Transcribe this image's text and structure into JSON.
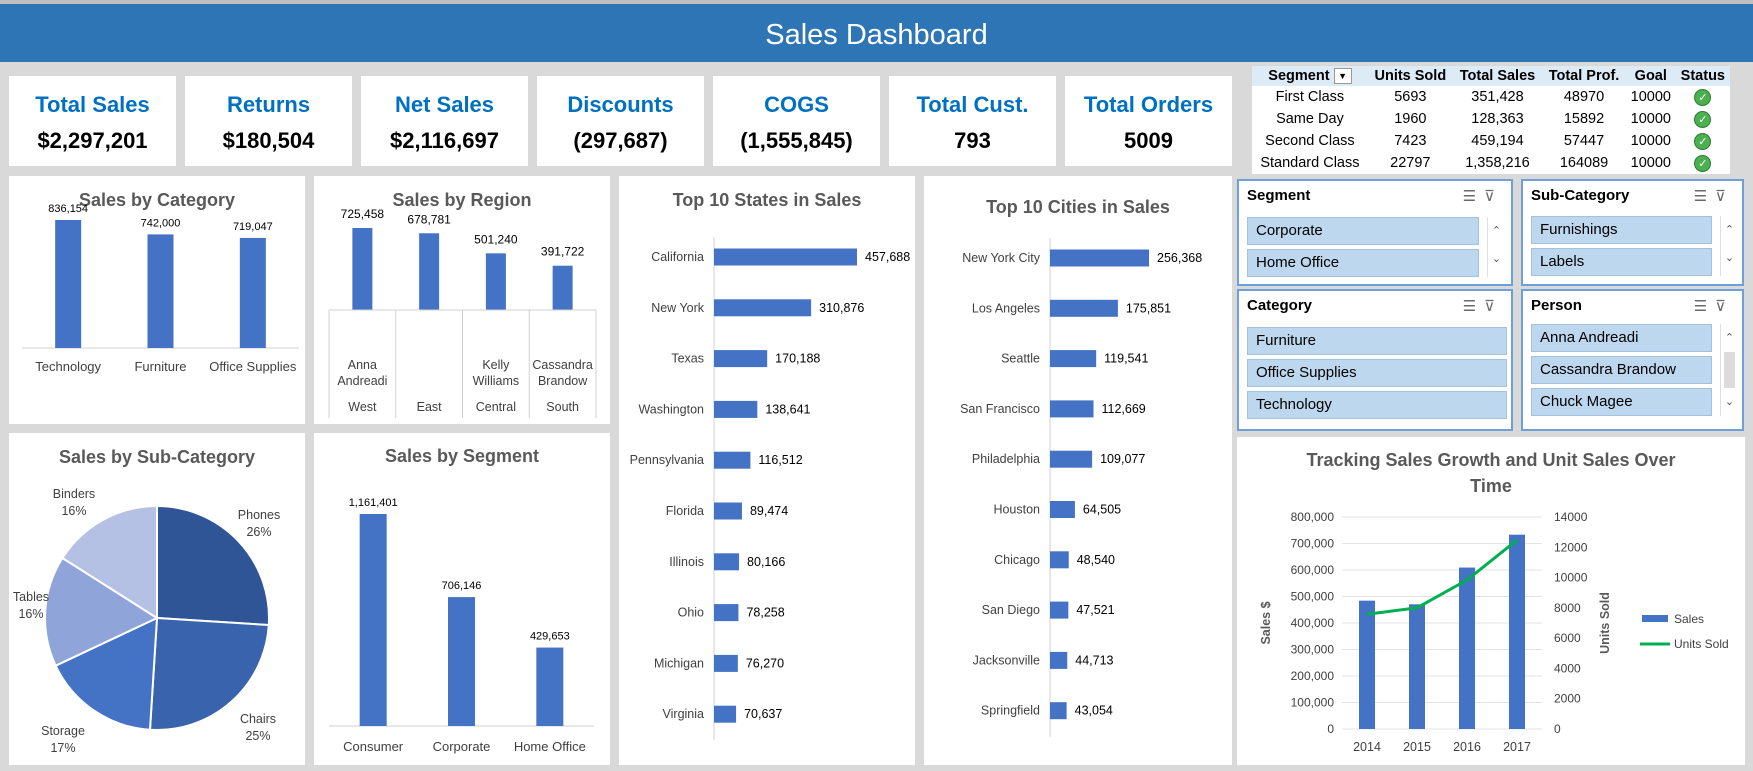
{
  "header": {
    "title": "Sales Dashboard"
  },
  "kpis": [
    {
      "label": "Total Sales",
      "value": "$2,297,201"
    },
    {
      "label": "Returns",
      "value": "$180,504"
    },
    {
      "label": "Net Sales",
      "value": "$2,116,697"
    },
    {
      "label": "Discounts",
      "value": "(297,687)"
    },
    {
      "label": "COGS",
      "value": "(1,555,845)"
    },
    {
      "label": "Total Cust.",
      "value": "793"
    },
    {
      "label": "Total Orders",
      "value": "5009"
    }
  ],
  "segment_table": {
    "headers": [
      "Segment",
      "Units Sold",
      "Total Sales",
      "Total Prof.",
      "Goal",
      "Status"
    ],
    "rows": [
      [
        "First Class",
        "5693",
        "351,428",
        "48970",
        "10000"
      ],
      [
        "Same Day",
        "1960",
        "128,363",
        "15892",
        "10000"
      ],
      [
        "Second Class",
        "7423",
        "459,194",
        "57447",
        "10000"
      ],
      [
        "Standard Class",
        "22797",
        "1,358,216",
        "164089",
        "10000"
      ]
    ],
    "status_icon": "check-circle-icon"
  },
  "slicers": {
    "segment": {
      "title": "Segment",
      "items": [
        "Corporate",
        "Home Office"
      ]
    },
    "subcategory": {
      "title": "Sub-Category",
      "items": [
        "Furnishings",
        "Labels"
      ]
    },
    "category": {
      "title": "Category",
      "items": [
        "Furniture",
        "Office Supplies",
        "Technology"
      ]
    },
    "person": {
      "title": "Person",
      "items": [
        "Anna Andreadi",
        "Cassandra Brandow",
        "Chuck Magee"
      ]
    }
  },
  "colors": {
    "header": "#2e75b6",
    "bar": "#4472c4",
    "kpi_title": "#0070c0",
    "units_line": "#00b050",
    "slicer_item": "#bdd7ee"
  },
  "chart_data": [
    {
      "id": "category",
      "type": "bar",
      "title": "Sales by Category",
      "categories": [
        "Technology",
        "Furniture",
        "Office Supplies"
      ],
      "values": [
        836154,
        742000,
        719047
      ],
      "labels": [
        "836,154",
        "742,000",
        "719,047"
      ]
    },
    {
      "id": "region",
      "type": "bar",
      "title": "Sales by Region",
      "categories": [
        "West",
        "East",
        "Central",
        "South"
      ],
      "managers": [
        "Anna Andreadi",
        "",
        "Kelly Williams",
        "Cassandra Brandow"
      ],
      "values": [
        725458,
        678781,
        501240,
        391722
      ],
      "labels": [
        "725,458",
        "678,781",
        "501,240",
        "391,722"
      ]
    },
    {
      "id": "states",
      "type": "bar",
      "orientation": "horizontal",
      "title": "Top 10 States in Sales",
      "categories": [
        "California",
        "New York",
        "Texas",
        "Washington",
        "Pennsylvania",
        "Florida",
        "Illinois",
        "Ohio",
        "Michigan",
        "Virginia"
      ],
      "values": [
        457688,
        310876,
        170188,
        138641,
        116512,
        89474,
        80166,
        78258,
        76270,
        70637
      ],
      "labels": [
        "457,688",
        "310,876",
        "170,188",
        "138,641",
        "116,512",
        "89,474",
        "80,166",
        "78,258",
        "76,270",
        "70,637"
      ]
    },
    {
      "id": "cities",
      "type": "bar",
      "orientation": "horizontal",
      "title": "Top 10 Cities in Sales",
      "categories": [
        "New York City",
        "Los Angeles",
        "Seattle",
        "San Francisco",
        "Philadelphia",
        "Houston",
        "Chicago",
        "San Diego",
        "Jacksonville",
        "Springfield"
      ],
      "values": [
        256368,
        175851,
        119541,
        112669,
        109077,
        64505,
        48540,
        47521,
        44713,
        43054
      ],
      "labels": [
        "256,368",
        "175,851",
        "119,541",
        "112,669",
        "109,077",
        "64,505",
        "48,540",
        "47,521",
        "44,713",
        "43,054"
      ]
    },
    {
      "id": "subcategory",
      "type": "pie",
      "title": "Sales by Sub-Category",
      "categories": [
        "Phones",
        "Chairs",
        "Storage",
        "Tables",
        "Binders"
      ],
      "values": [
        26,
        25,
        17,
        16,
        16
      ],
      "labels": [
        "26%",
        "25%",
        "17%",
        "16%",
        "16%"
      ],
      "colors": [
        "#2f5597",
        "#3a63ad",
        "#4472c4",
        "#8fa4d8",
        "#b4c0e4"
      ]
    },
    {
      "id": "segment",
      "type": "bar",
      "title": "Sales by Segment",
      "categories": [
        "Consumer",
        "Corporate",
        "Home Office"
      ],
      "values": [
        1161401,
        706146,
        429653
      ],
      "labels": [
        "1,161,401",
        "706,146",
        "429,653"
      ]
    },
    {
      "id": "growth",
      "type": "bar",
      "title": "Tracking Sales Growth and Unit Sales Over Time",
      "x": [
        "2014",
        "2015",
        "2016",
        "2017"
      ],
      "ylabel": "Sales $",
      "y2label": "Units Sold",
      "ylim": [
        0,
        800000
      ],
      "y2lim": [
        0,
        14000
      ],
      "yticks": [
        "0",
        "100,000",
        "200,000",
        "300,000",
        "400,000",
        "500,000",
        "600,000",
        "700,000",
        "800,000"
      ],
      "y2ticks": [
        "0",
        "2000",
        "4000",
        "6000",
        "8000",
        "10000",
        "12000",
        "14000"
      ],
      "series": [
        {
          "name": "Sales",
          "type": "bar",
          "axis": "left",
          "values": [
            484247,
            470533,
            609206,
            733215
          ]
        },
        {
          "name": "Units Sold",
          "type": "line",
          "axis": "right",
          "values": [
            7581,
            8000,
            9837,
            12476
          ]
        }
      ],
      "legend": "right"
    }
  ]
}
